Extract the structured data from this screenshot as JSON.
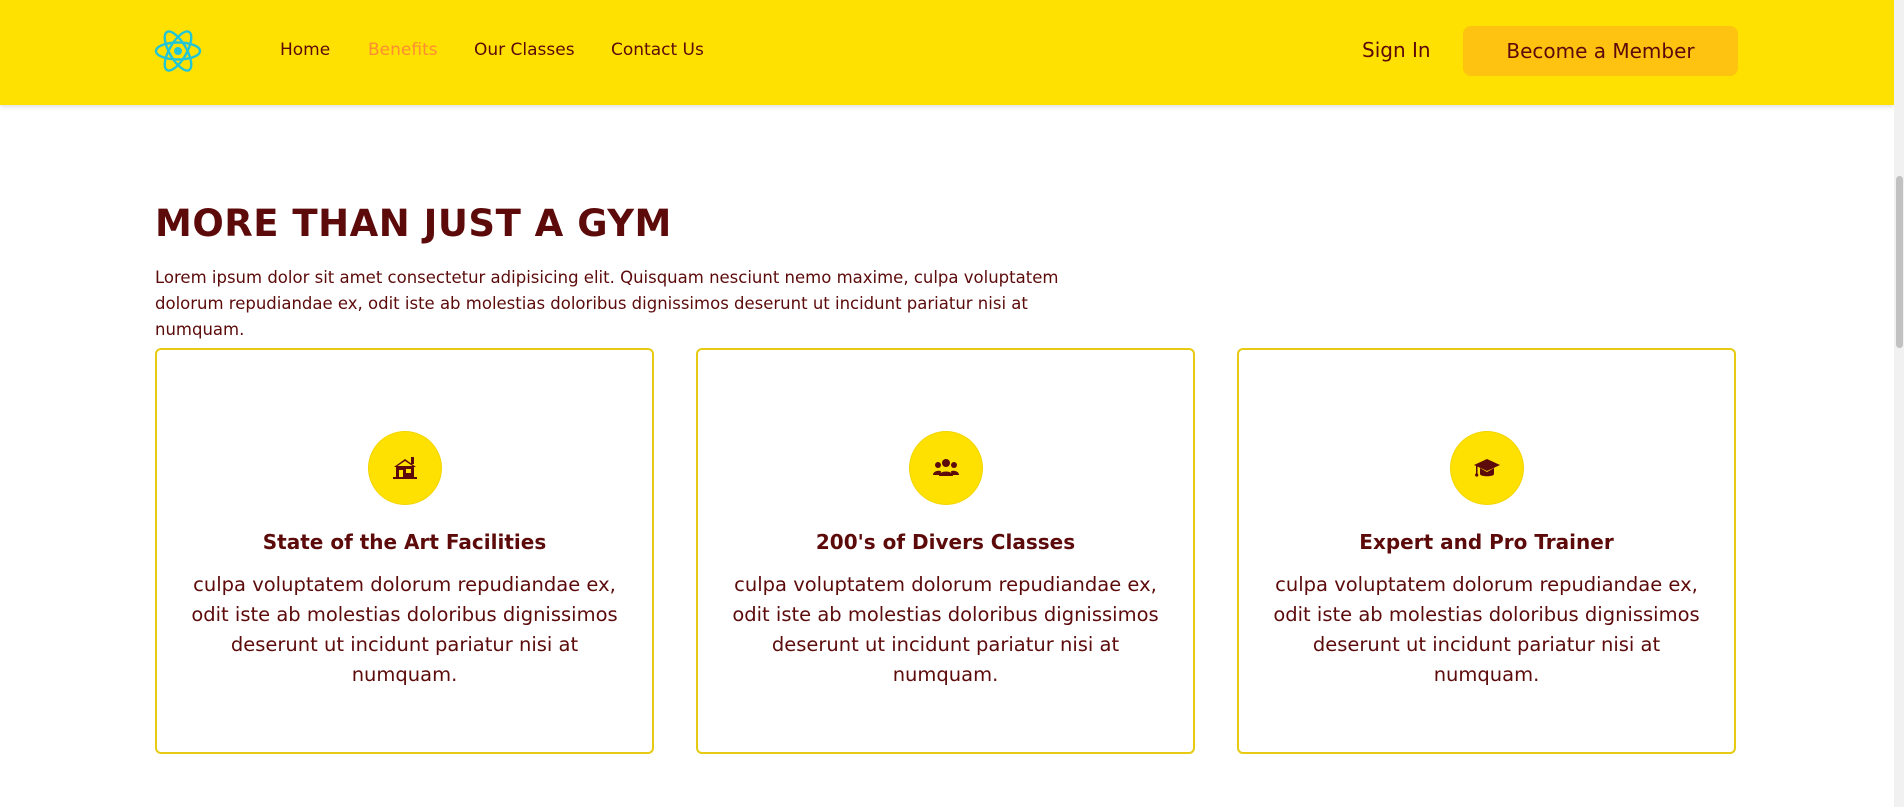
{
  "nav": {
    "logo_icon": "react-atom-icon",
    "links": [
      {
        "label": "Home",
        "active": false
      },
      {
        "label": "Benefits",
        "active": true
      },
      {
        "label": "Our Classes",
        "active": false
      },
      {
        "label": "Contact Us",
        "active": false
      }
    ],
    "sign_in_label": "Sign In",
    "cta_label": "Become a Member"
  },
  "colors": {
    "navbar_bg": "#ffe101",
    "active_link": "#ff8d33",
    "cta_bg": "#fdc310",
    "text": "#5c0a0a",
    "card_border": "#e6cb12"
  },
  "section": {
    "title": "MORE THAN JUST A GYM",
    "intro": "Lorem ipsum dolor sit amet consectetur adipisicing elit. Quisquam nesciunt nemo maxime, culpa voluptatem dolorum repudiandae ex, odit iste ab molestias doloribus dignissimos deserunt ut incidunt pariatur nisi at numquam."
  },
  "cards": [
    {
      "icon": "house-icon",
      "title": "State of the Art Facilities",
      "text": "culpa voluptatem dolorum repudiandae ex, odit iste ab molestias doloribus dignissimos deserunt ut incidunt pariatur nisi at numquam."
    },
    {
      "icon": "people-group-icon",
      "title": "200's of Divers Classes",
      "text": "culpa voluptatem dolorum repudiandae ex, odit iste ab molestias doloribus dignissimos deserunt ut incidunt pariatur nisi at numquam."
    },
    {
      "icon": "graduation-cap-icon",
      "title": "Expert and Pro Trainer",
      "text": "culpa voluptatem dolorum repudiandae ex, odit iste ab molestias doloribus dignissimos deserunt ut incidunt pariatur nisi at numquam."
    }
  ]
}
